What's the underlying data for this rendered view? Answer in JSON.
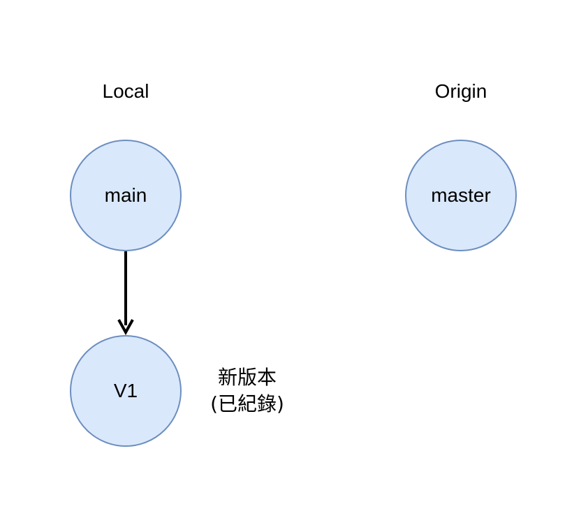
{
  "columns": {
    "local_title": "Local",
    "origin_title": "Origin"
  },
  "nodes": {
    "main": "main",
    "master": "master",
    "v1": "V1"
  },
  "note": {
    "line1": "新版本",
    "line2": "(已紀錄)"
  },
  "colors": {
    "node_fill": "#dae8fc",
    "node_stroke": "#6c8ebf",
    "arrow": "#000000"
  }
}
